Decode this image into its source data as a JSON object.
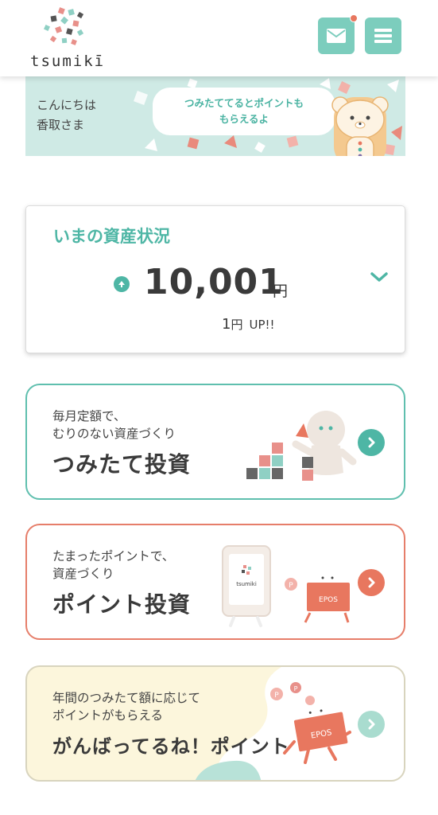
{
  "header": {
    "logo_text": "tsumikī",
    "mail_icon": "mail-icon",
    "menu_icon": "hamburger-menu-icon",
    "has_notification": true
  },
  "banner": {
    "greeting_line1": "こんにちは",
    "greeting_line2": "香取さま",
    "bubble_line1": "つみたててるとポイントも",
    "bubble_line2": "もらえるよ"
  },
  "assets": {
    "title": "いまの資産状況",
    "amount": "10,001",
    "amount_unit": "円",
    "diff_value": "1",
    "diff_unit": "円",
    "diff_label": "UP!!"
  },
  "menus": [
    {
      "sub_line1": "毎月定額で、",
      "sub_line2": "むりのない資産づくり",
      "title": "つみたて投資"
    },
    {
      "sub_line1": "たまったポイントで、",
      "sub_line2": "資産づくり",
      "title": "ポイント投資",
      "phone_logo": "tsumiki",
      "card_label": "EPOS"
    },
    {
      "sub_line1": "年間のつみたて額に応じて",
      "sub_line2": "ポイントがもらえる",
      "title": "がんばってるね！ポイント",
      "card_label": "EPOS"
    }
  ],
  "colors": {
    "teal": "#4eb6a5",
    "coral": "#e8775f",
    "mint_bg": "#cfeae5",
    "yellow_bg": "#fcf6dc"
  }
}
